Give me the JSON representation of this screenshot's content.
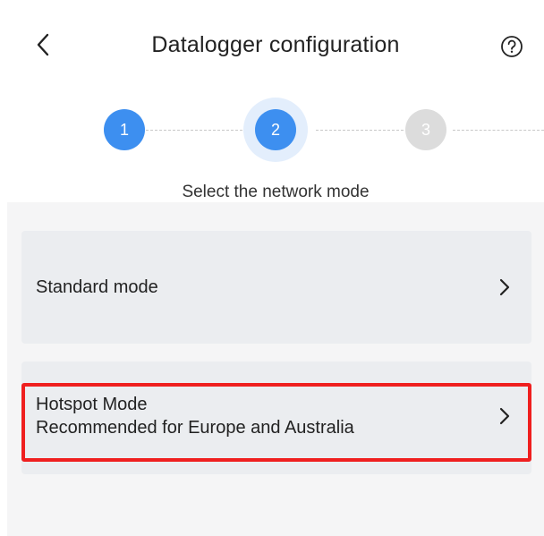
{
  "header": {
    "title": "Datalogger configuration",
    "back_icon": "chevron-left-icon",
    "help_icon": "help-circle-icon"
  },
  "stepper": {
    "steps": [
      {
        "label": "1",
        "state": "done"
      },
      {
        "label": "2",
        "state": "active"
      },
      {
        "label": "3",
        "state": "pending"
      }
    ],
    "caption": "Select the network mode"
  },
  "options": [
    {
      "title": "Standard mode",
      "subtitle": ""
    },
    {
      "title": "Hotspot Mode",
      "subtitle": "Recommended for Europe and Australia"
    }
  ],
  "colors": {
    "accent": "#3d8ff0",
    "pending": "#dcdcdc",
    "halo": "#e3eefc",
    "highlight": "#ef1f1f"
  }
}
